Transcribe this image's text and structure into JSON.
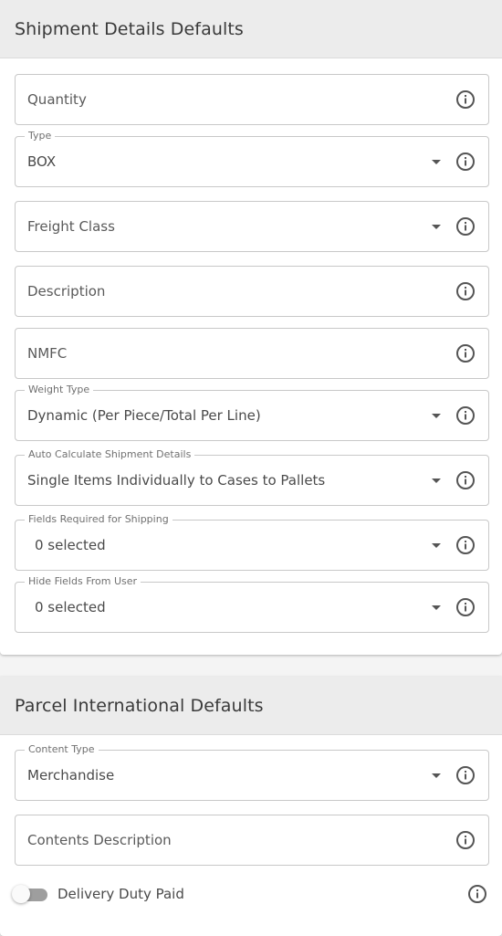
{
  "shipment_details": {
    "title": "Shipment Details Defaults",
    "fields": [
      {
        "label": "",
        "value": "Quantity",
        "kind": "text"
      },
      {
        "label": "Type",
        "value": "BOX",
        "kind": "select"
      },
      {
        "label": "",
        "value": "Freight Class",
        "kind": "select"
      },
      {
        "label": "",
        "value": "Description",
        "kind": "text"
      },
      {
        "label": "",
        "value": "NMFC",
        "kind": "text"
      },
      {
        "label": "Weight Type",
        "value": "Dynamic (Per Piece/Total Per Line)",
        "kind": "select"
      },
      {
        "label": "Auto Calculate Shipment Details",
        "value": "Single Items Individually to Cases to Pallets",
        "kind": "select"
      },
      {
        "label": "Fields Required for Shipping",
        "value": "0 selected",
        "kind": "multiselect"
      },
      {
        "label": "Hide Fields From User",
        "value": "0 selected",
        "kind": "multiselect"
      }
    ]
  },
  "parcel_international": {
    "title": "Parcel International Defaults",
    "fields": [
      {
        "label": "Content Type",
        "value": "Merchandise",
        "kind": "select"
      },
      {
        "label": "",
        "value": "Contents Description",
        "kind": "text"
      }
    ],
    "toggle": {
      "label": "Delivery Duty Paid",
      "on": false
    }
  },
  "colors": {
    "header_bg": "#ececec",
    "border": "#c8c8c8",
    "text": "#4a4a4a",
    "toggle_track": "#9e9e9e"
  },
  "icons": {
    "info": "info-circle-icon",
    "dropdown": "triangle-down-icon"
  }
}
